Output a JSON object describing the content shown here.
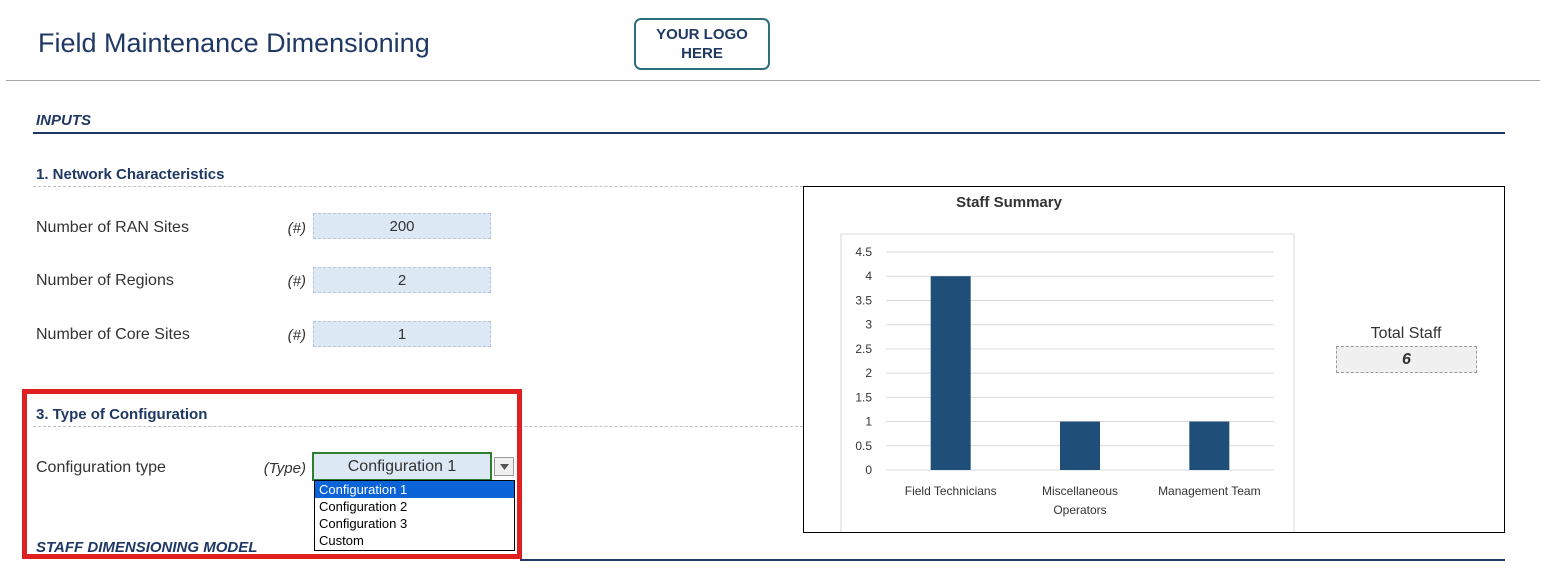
{
  "header": {
    "title": "Field Maintenance Dimensioning",
    "logo_text": "YOUR LOGO HERE"
  },
  "inputs_section": {
    "title": "INPUTS"
  },
  "network": {
    "title": "1. Network Characteristics",
    "rows": [
      {
        "label": "Number of RAN Sites",
        "unit": "(#)",
        "value": "200"
      },
      {
        "label": "Number of Regions",
        "unit": "(#)",
        "value": "2"
      },
      {
        "label": "Number of Core Sites",
        "unit": "(#)",
        "value": "1"
      }
    ]
  },
  "configuration": {
    "title": "3. Type of Configuration",
    "label": "Configuration type",
    "unit": "(Type)",
    "selected": "Configuration 1",
    "options": [
      "Configuration 1",
      "Configuration 2",
      "Configuration 3",
      "Custom"
    ]
  },
  "model_section": {
    "title": "STAFF DIMENSIONING MODEL"
  },
  "total": {
    "label": "Total Staff",
    "value": "6"
  },
  "colors": {
    "bar": "#1f4e79",
    "accent": "#1f3864",
    "highlight": "#e02020"
  },
  "chart_data": {
    "type": "bar",
    "title": "Staff Summary",
    "categories": [
      "Field Technicians",
      "Miscellaneous Operators",
      "Management Team"
    ],
    "values": [
      4,
      1,
      1
    ],
    "yticks": [
      "0",
      "0.5",
      "1",
      "1.5",
      "2",
      "2.5",
      "3",
      "3.5",
      "4",
      "4.5"
    ],
    "ylim": [
      0,
      4.5
    ],
    "xlabel": "",
    "ylabel": "",
    "grid": true
  }
}
